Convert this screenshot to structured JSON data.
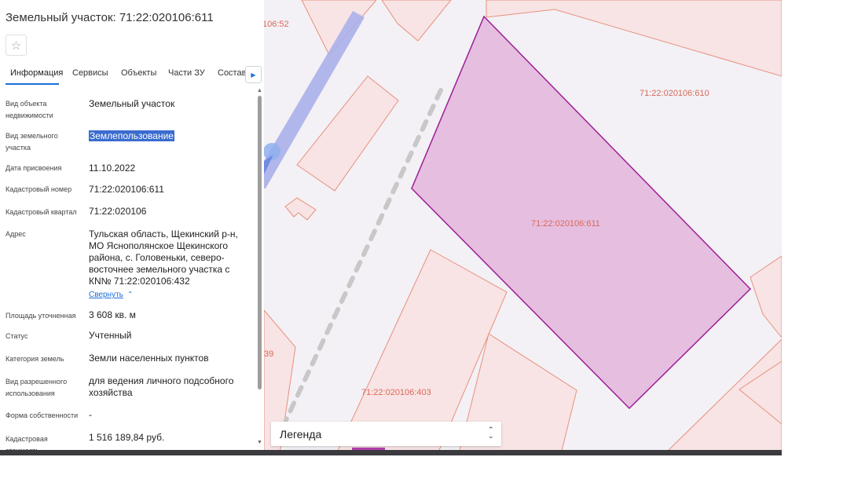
{
  "header": {
    "title": "Земельный участок: 71:22:020106:611",
    "favorite_icon": "star-icon"
  },
  "tabs": [
    {
      "label": "Информация",
      "active": true
    },
    {
      "label": "Сервисы"
    },
    {
      "label": "Объекты"
    },
    {
      "label": "Части ЗУ"
    },
    {
      "label": "Состав"
    }
  ],
  "tabs_next_icon": "chevron-right-icon",
  "info": {
    "object_type_label": "Вид объекта недвижимости",
    "object_type_value": "Земельный участок",
    "land_kind_label": "Вид земельного участка",
    "land_kind_value": "Землепользование",
    "date_label": "Дата присвоения",
    "date_value": "11.10.2022",
    "cad_number_label": "Кадастровый номер",
    "cad_number_value": "71:22:020106:611",
    "cad_quarter_label": "Кадастровый квартал",
    "cad_quarter_value": "71:22:020106",
    "address_label": "Адрес",
    "address_value": "Тульская область, Щекинский р-н, МО Яснополянское Щекинского района, с. Головеньки, северо-восточнее земельного участка с КN№ 71:22:020106:432",
    "collapse_link": "Свернуть",
    "area_label": "Площадь уточненная",
    "area_value": "3 608 кв. м",
    "status_label": "Статус",
    "status_value": "Учтенный",
    "category_label": "Категория земель",
    "category_value": "Земли населенных пунктов",
    "permitted_use_label": "Вид разрешенного использования",
    "permitted_use_value": "для ведения личного подсобного хозяйства",
    "ownership_label": "Форма собственности",
    "ownership_value": "-",
    "cad_value_label": "Кадастровая стоимость",
    "cad_value_value": "1 516 189,84 руб."
  },
  "map": {
    "labels": {
      "parcel_610": "71:22:020106:610",
      "parcel_611": "71:22:020106:611",
      "parcel_403": "71:22:020106:403",
      "partial_52": "106:52",
      "partial_39": "39"
    },
    "colors": {
      "parcel_fill": "#f8e4e4",
      "parcel_stroke": "#e8907f",
      "selected_fill": "#e6bedf",
      "selected_stroke": "#9c1f98",
      "label": "#d86a5a"
    },
    "legend_label": "Легенда"
  }
}
